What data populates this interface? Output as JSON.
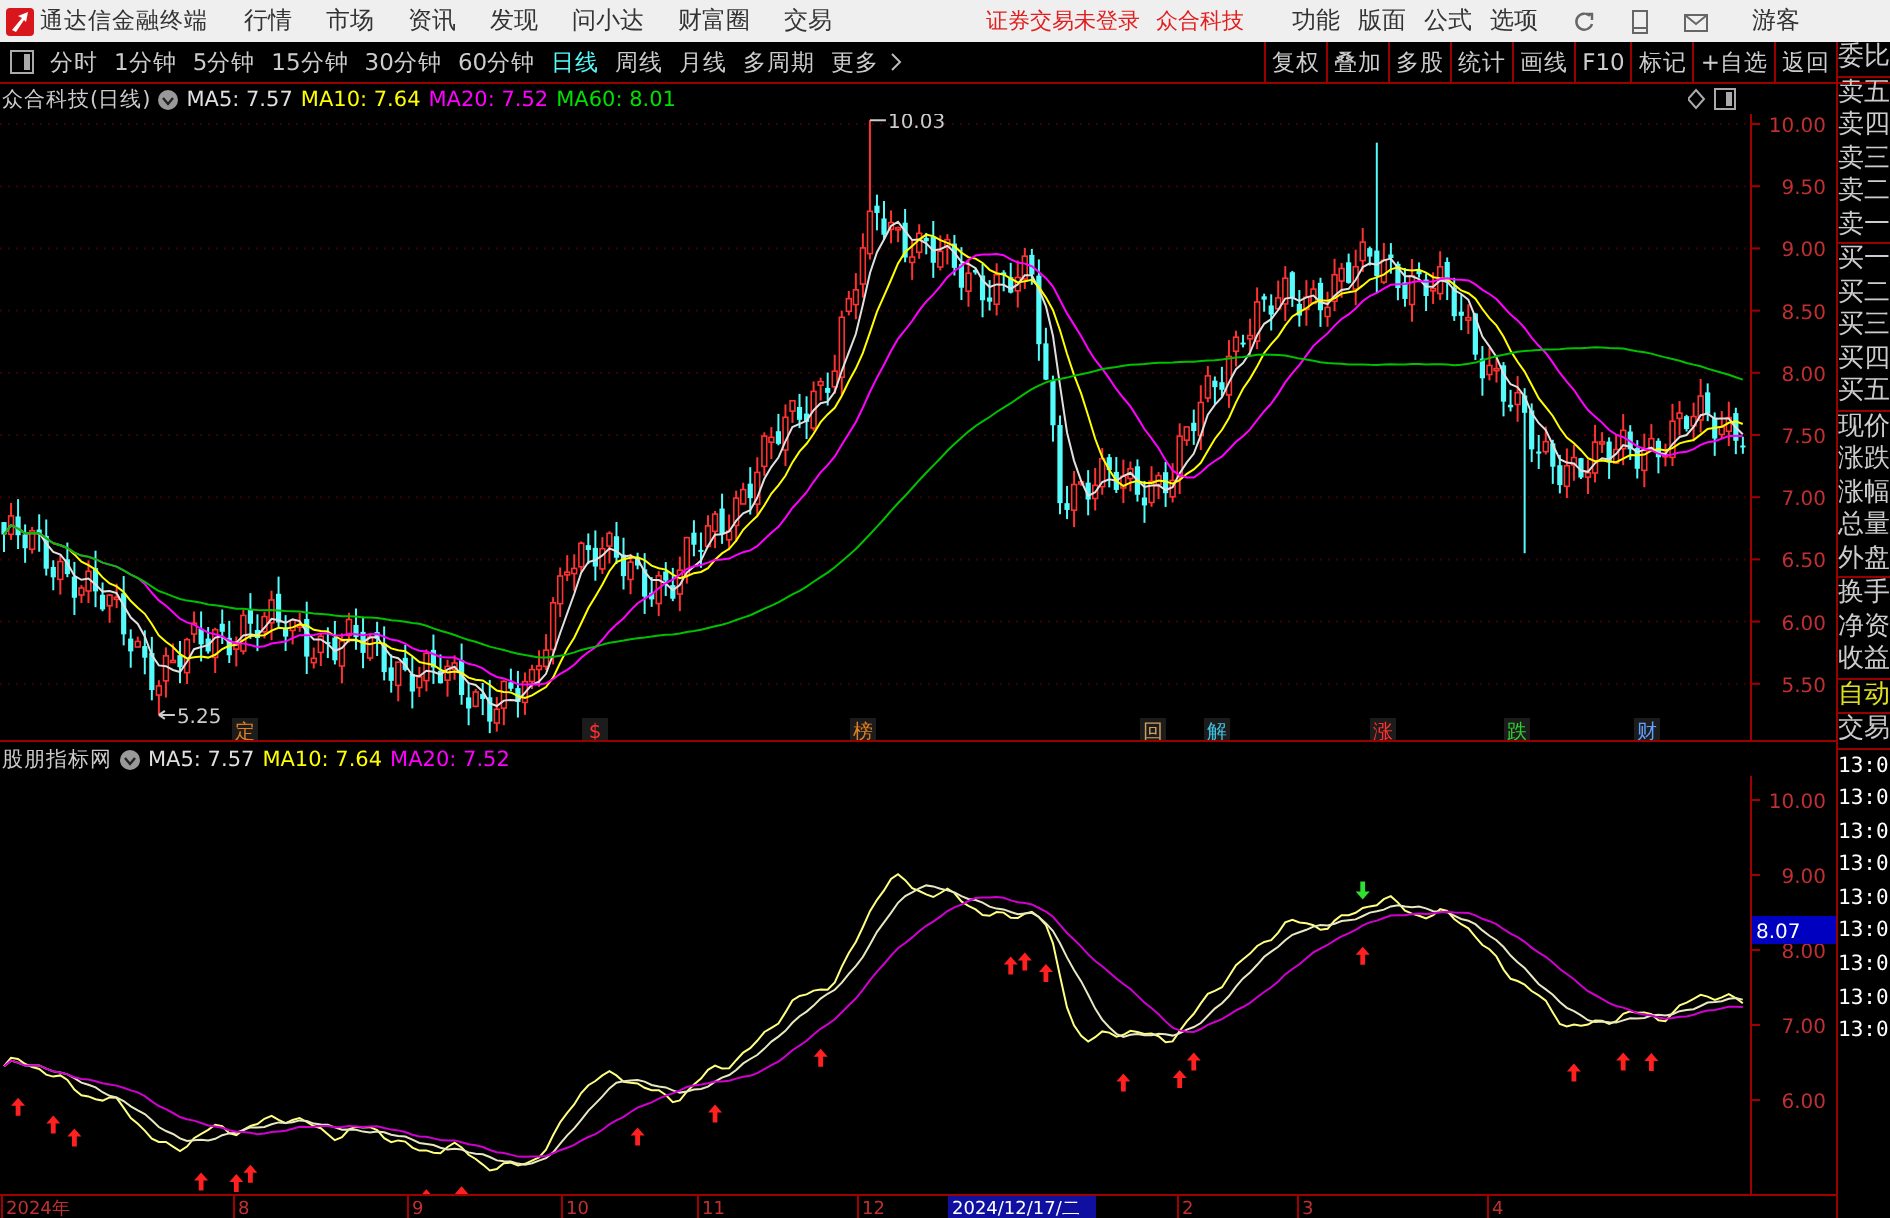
{
  "app": {
    "title": "通达信金融终端",
    "menu": [
      "行情",
      "市场",
      "资讯",
      "发现",
      "问小达",
      "财富圈",
      "交易"
    ],
    "notice": "证券交易未登录",
    "stock_link": "众合科技",
    "right_menu": [
      "功能",
      "版面",
      "公式",
      "选项"
    ],
    "user": "游客"
  },
  "periods": [
    {
      "label": "分时",
      "selected": false
    },
    {
      "label": "1分钟",
      "selected": false
    },
    {
      "label": "5分钟",
      "selected": false
    },
    {
      "label": "15分钟",
      "selected": false
    },
    {
      "label": "30分钟",
      "selected": false
    },
    {
      "label": "60分钟",
      "selected": false
    },
    {
      "label": "日线",
      "selected": true
    },
    {
      "label": "周线",
      "selected": false
    },
    {
      "label": "月线",
      "selected": false
    },
    {
      "label": "多周期",
      "selected": false
    },
    {
      "label": "更多",
      "selected": false
    }
  ],
  "tools": [
    "复权",
    "叠加",
    "多股",
    "统计",
    "画线",
    "F10",
    "标记",
    "+自选",
    "返回"
  ],
  "main_chart": {
    "title": "众合科技(日线)",
    "ma": [
      {
        "label": "MA5: 7.57",
        "color": "#e0e0e0"
      },
      {
        "label": "MA10: 7.64",
        "color": "#ffff00"
      },
      {
        "label": "MA20: 7.52",
        "color": "#ff00ff"
      },
      {
        "label": "MA60: 8.01",
        "color": "#00e000"
      }
    ],
    "yticks": [
      "10.00",
      "9.50",
      "9.00",
      "8.50",
      "8.00",
      "7.50",
      "7.00",
      "6.50",
      "6.00",
      "5.50"
    ],
    "high_label": "10.03",
    "low_label": "5.25",
    "events": [
      {
        "label": "定",
        "color": "#e08020"
      },
      {
        "label": "$",
        "color": "#ff3030"
      },
      {
        "label": "榜",
        "color": "#e08020"
      },
      {
        "label": "回",
        "color": "#d0a060"
      },
      {
        "label": "解",
        "color": "#40c0e0"
      },
      {
        "label": "涨",
        "color": "#ff3030"
      },
      {
        "label": "跌",
        "color": "#30d030"
      },
      {
        "label": "财",
        "color": "#60a0ff"
      }
    ]
  },
  "indicator_chart": {
    "title": "股朋指标网",
    "ma": [
      {
        "label": "MA5: 7.57",
        "color": "#e0e0e0"
      },
      {
        "label": "MA10: 7.64",
        "color": "#ffff00"
      },
      {
        "label": "MA20: 7.52",
        "color": "#ff00ff"
      }
    ],
    "yticks": [
      "10.00",
      "9.00",
      "8.00",
      "7.00",
      "6.00"
    ],
    "current": "8.07"
  },
  "x_axis": [
    {
      "label": "2024年",
      "kind": "tick"
    },
    {
      "label": "8",
      "kind": "tick"
    },
    {
      "label": "9",
      "kind": "tick"
    },
    {
      "label": "10",
      "kind": "tick"
    },
    {
      "label": "11",
      "kind": "tick"
    },
    {
      "label": "12",
      "kind": "tick"
    },
    {
      "label": "2024/12/17/二",
      "kind": "cursor"
    },
    {
      "label": "2",
      "kind": "tick"
    },
    {
      "label": "3",
      "kind": "tick"
    },
    {
      "label": "4",
      "kind": "tick"
    }
  ],
  "quote_panel": {
    "groups": [
      [
        "委比"
      ],
      [
        "卖五",
        "卖四",
        "卖三",
        "卖二",
        "卖一"
      ],
      [
        "买一",
        "买二",
        "买三",
        "买四",
        "买五"
      ],
      [
        "现价",
        "涨跌",
        "涨幅",
        "总量",
        "外盘"
      ],
      [
        "换手",
        "净资",
        "收益"
      ]
    ],
    "auto_trade": "自动",
    "trade": "交易",
    "times": [
      "13:0",
      "13:0",
      "13:0",
      "13:0",
      "13:0",
      "13:0",
      "13:0",
      "13:0",
      "13:0"
    ]
  }
}
